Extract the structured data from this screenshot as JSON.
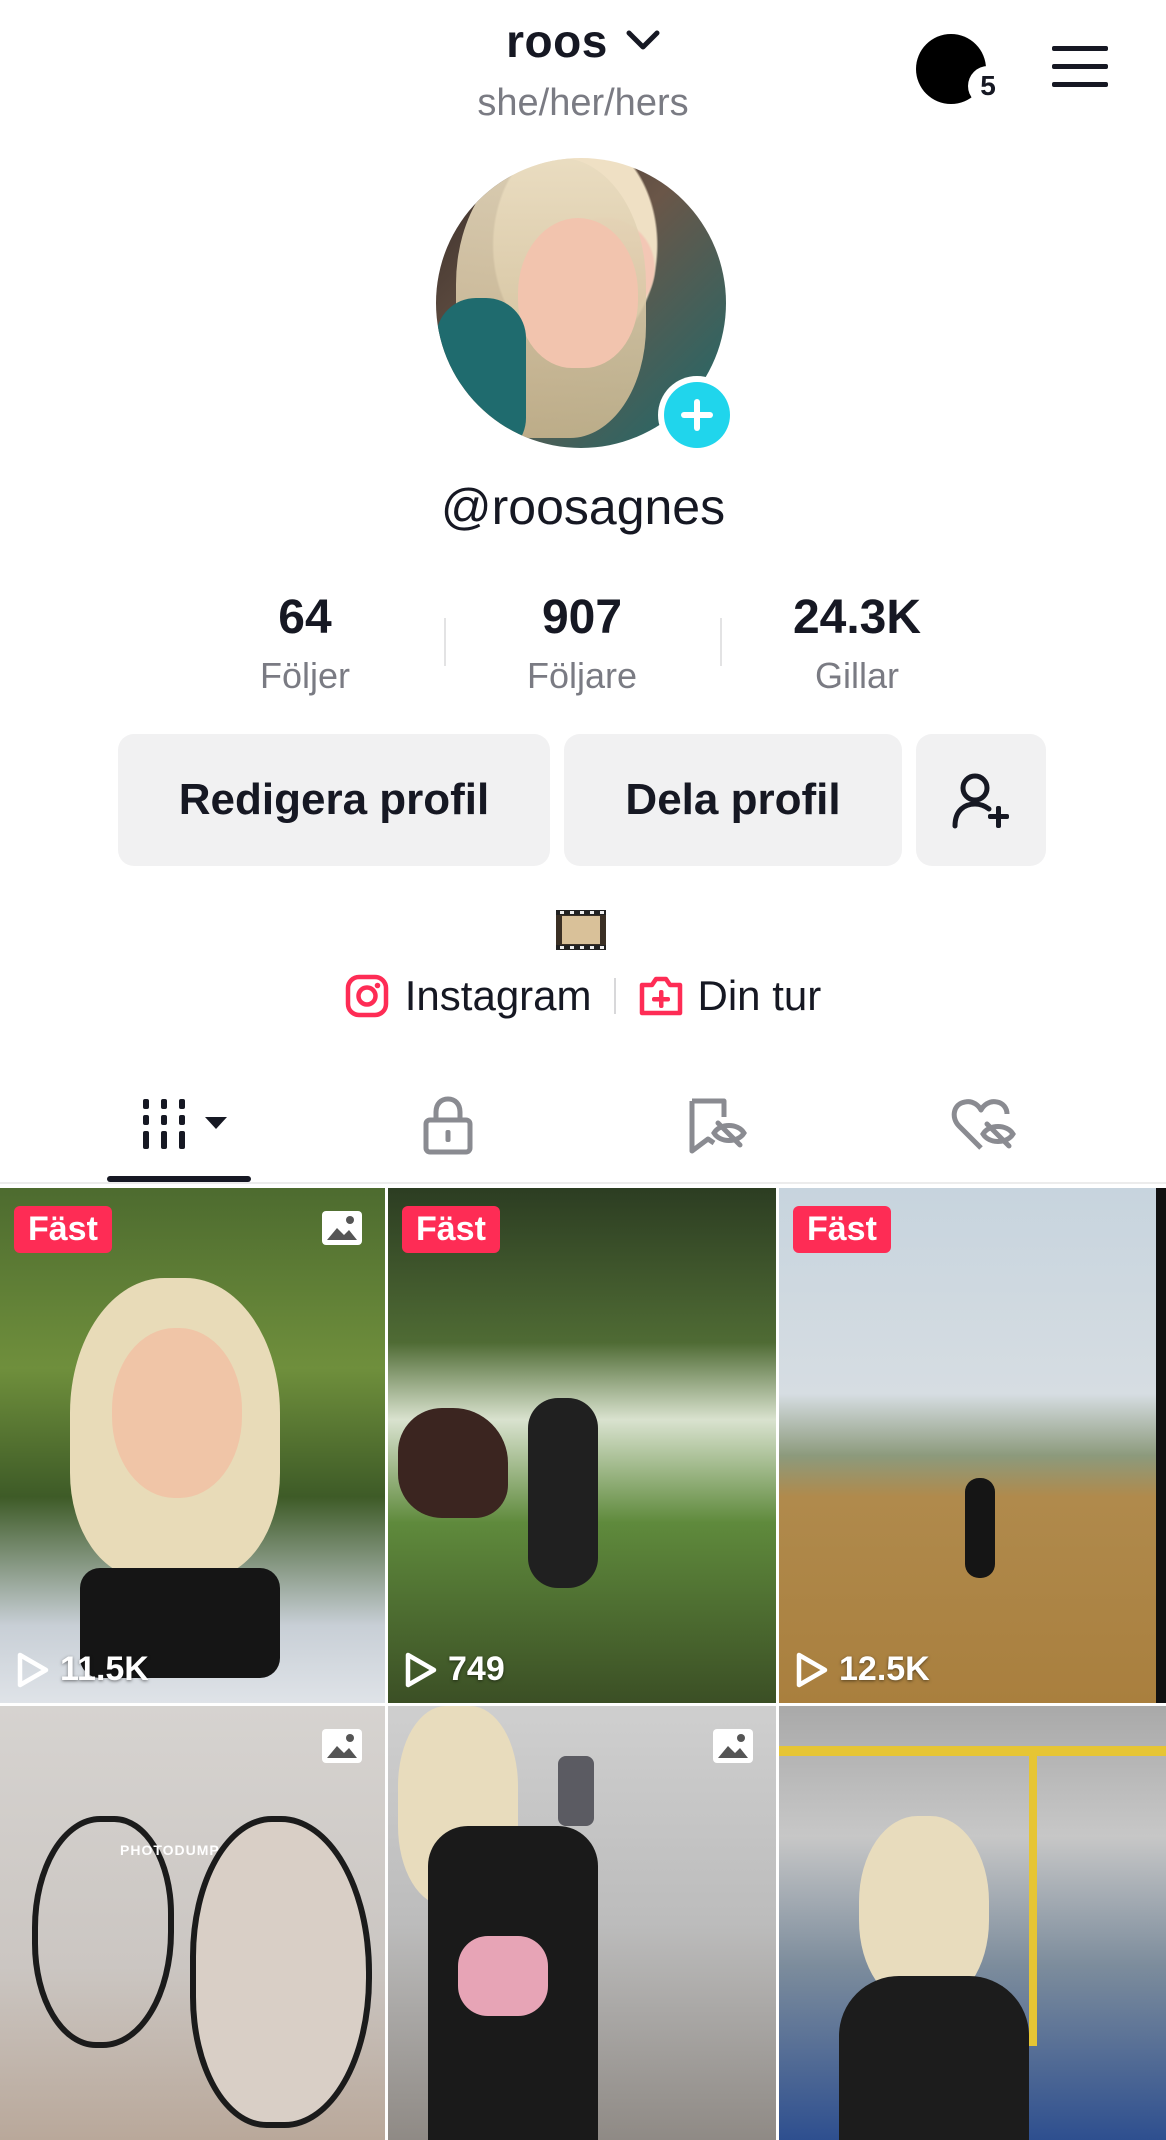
{
  "header": {
    "username": "roos",
    "pronouns": "she/her/hers",
    "notification_count": "5"
  },
  "profile": {
    "handle": "@roosagnes"
  },
  "stats": [
    {
      "value": "64",
      "label": "Följer"
    },
    {
      "value": "907",
      "label": "Följare"
    },
    {
      "value": "24.3K",
      "label": "Gillar"
    }
  ],
  "actions": {
    "edit_label": "Redigera profil",
    "share_label": "Dela profil"
  },
  "bio": {
    "emoji": "🎞️"
  },
  "links": {
    "instagram_label": "Instagram",
    "din_tur_label": "Din tur"
  },
  "tabs": [
    "videos",
    "private",
    "saved",
    "liked"
  ],
  "grid": [
    {
      "pinned": "Fäst",
      "views": "11.5K",
      "type": "photo"
    },
    {
      "pinned": "Fäst",
      "views": "749",
      "type": "video"
    },
    {
      "pinned": "Fäst",
      "views": "12.5K",
      "type": "video"
    },
    {
      "overlay_text": "PHOTODUMP",
      "type": "photo"
    },
    {
      "type": "photo"
    },
    {
      "type": "video"
    }
  ],
  "colors": {
    "accent": "#fe2c55",
    "add_button": "#20d5ec",
    "text": "#161823",
    "secondary_text": "#7a7b83",
    "button_bg": "#f1f1f2"
  }
}
